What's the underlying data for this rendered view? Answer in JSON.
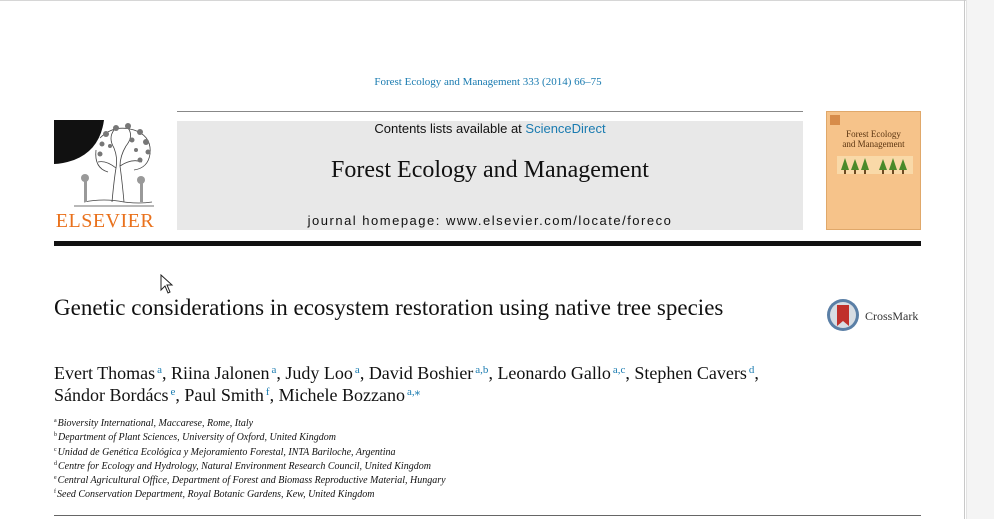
{
  "citation": "Forest Ecology and Management 333 (2014) 66–75",
  "publisher": {
    "wordmark": "ELSEVIER"
  },
  "header": {
    "contents_prefix": "Contents lists available at ",
    "contents_link": "ScienceDirect",
    "journal_name": "Forest Ecology and Management",
    "homepage": "journal homepage: www.elsevier.com/locate/foreco"
  },
  "cover": {
    "title_line1": "Forest Ecology",
    "title_line2": "and Management"
  },
  "article": {
    "title": "Genetic considerations in ecosystem restoration using native tree species"
  },
  "crossmark": {
    "label": "CrossMark"
  },
  "authors": [
    {
      "name": "Evert Thomas",
      "sup": "a",
      "sep": ", "
    },
    {
      "name": "Riina Jalonen",
      "sup": "a",
      "sep": ", "
    },
    {
      "name": "Judy Loo",
      "sup": "a",
      "sep": ", "
    },
    {
      "name": "David Boshier",
      "sup": "a,b",
      "sep": ", "
    },
    {
      "name": "Leonardo Gallo",
      "sup": "a,c",
      "sep": ", "
    },
    {
      "name": "Stephen Cavers",
      "sup": "d",
      "sep": ", "
    },
    {
      "name": "Sándor Bordács",
      "sup": "e",
      "sep": ", "
    },
    {
      "name": "Paul Smith",
      "sup": "f",
      "sep": ", "
    },
    {
      "name": "Michele Bozzano",
      "sup": "a,⁎",
      "sep": ""
    }
  ],
  "affiliations": [
    {
      "key": "a",
      "text": "Bioversity International, Maccarese, Rome, Italy"
    },
    {
      "key": "b",
      "text": "Department of Plant Sciences, University of Oxford, United Kingdom"
    },
    {
      "key": "c",
      "text": "Unidad de Genética Ecológica y Mejoramiento Forestal, INTA Bariloche, Argentina"
    },
    {
      "key": "d",
      "text": "Centre for Ecology and Hydrology, Natural Environment Research Council, United Kingdom"
    },
    {
      "key": "e",
      "text": "Central Agricultural Office, Department of Forest and Biomass Reproductive Material, Hungary"
    },
    {
      "key": "f",
      "text": "Seed Conservation Department, Royal Botanic Gardens, Kew, United Kingdom"
    }
  ],
  "colors": {
    "link": "#1a7bb0",
    "elsevier_orange": "#e9711c",
    "cover": "#f6c38a"
  }
}
